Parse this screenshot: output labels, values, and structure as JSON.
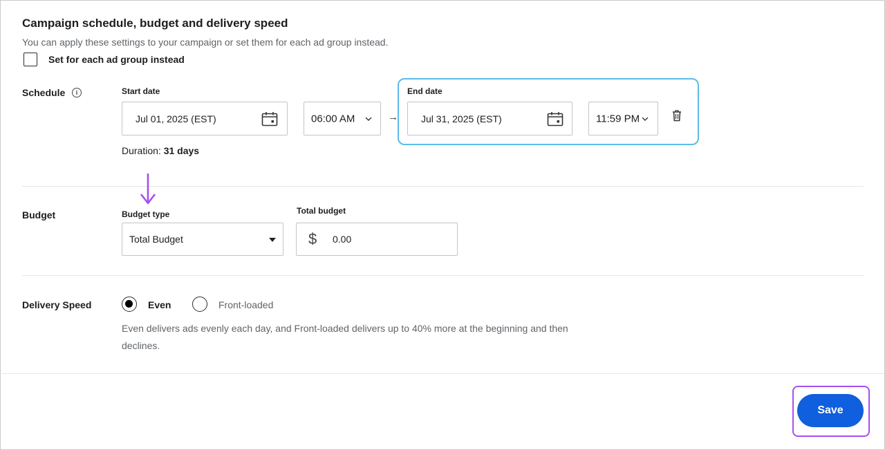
{
  "section": {
    "title": "Campaign schedule, budget and delivery speed",
    "subtitle": "You can apply these settings to your campaign or set them for each ad group instead.",
    "checkbox_label": "Set for each ad group instead",
    "checkbox_checked": false
  },
  "schedule": {
    "label": "Schedule",
    "info_icon": "info-icon",
    "start_label": "Start date",
    "start_date": "Jul 01, 2025 (EST)",
    "start_time": "06:00 AM",
    "arrow": "→",
    "end_label": "End date",
    "end_date": "Jul 31, 2025 (EST)",
    "end_time": "11:59 PM",
    "duration_prefix": "Duration:",
    "duration_value": "31 days"
  },
  "budget": {
    "label": "Budget",
    "type_label": "Budget type",
    "type_value": "Total Budget",
    "total_label": "Total budget",
    "currency_symbol": "$",
    "total_value": "0.00"
  },
  "delivery": {
    "label": "Delivery Speed",
    "options": [
      {
        "label": "Even",
        "selected": true
      },
      {
        "label": "Front-loaded",
        "selected": false
      }
    ],
    "description": "Even delivers ads evenly each day, and Front-loaded delivers up to 40% more at the beginning and then declines."
  },
  "footer": {
    "save_label": "Save"
  },
  "colors": {
    "primary": "#0f5fde",
    "highlight_blue": "#5bbbe8",
    "highlight_purple": "#a64ff0"
  }
}
